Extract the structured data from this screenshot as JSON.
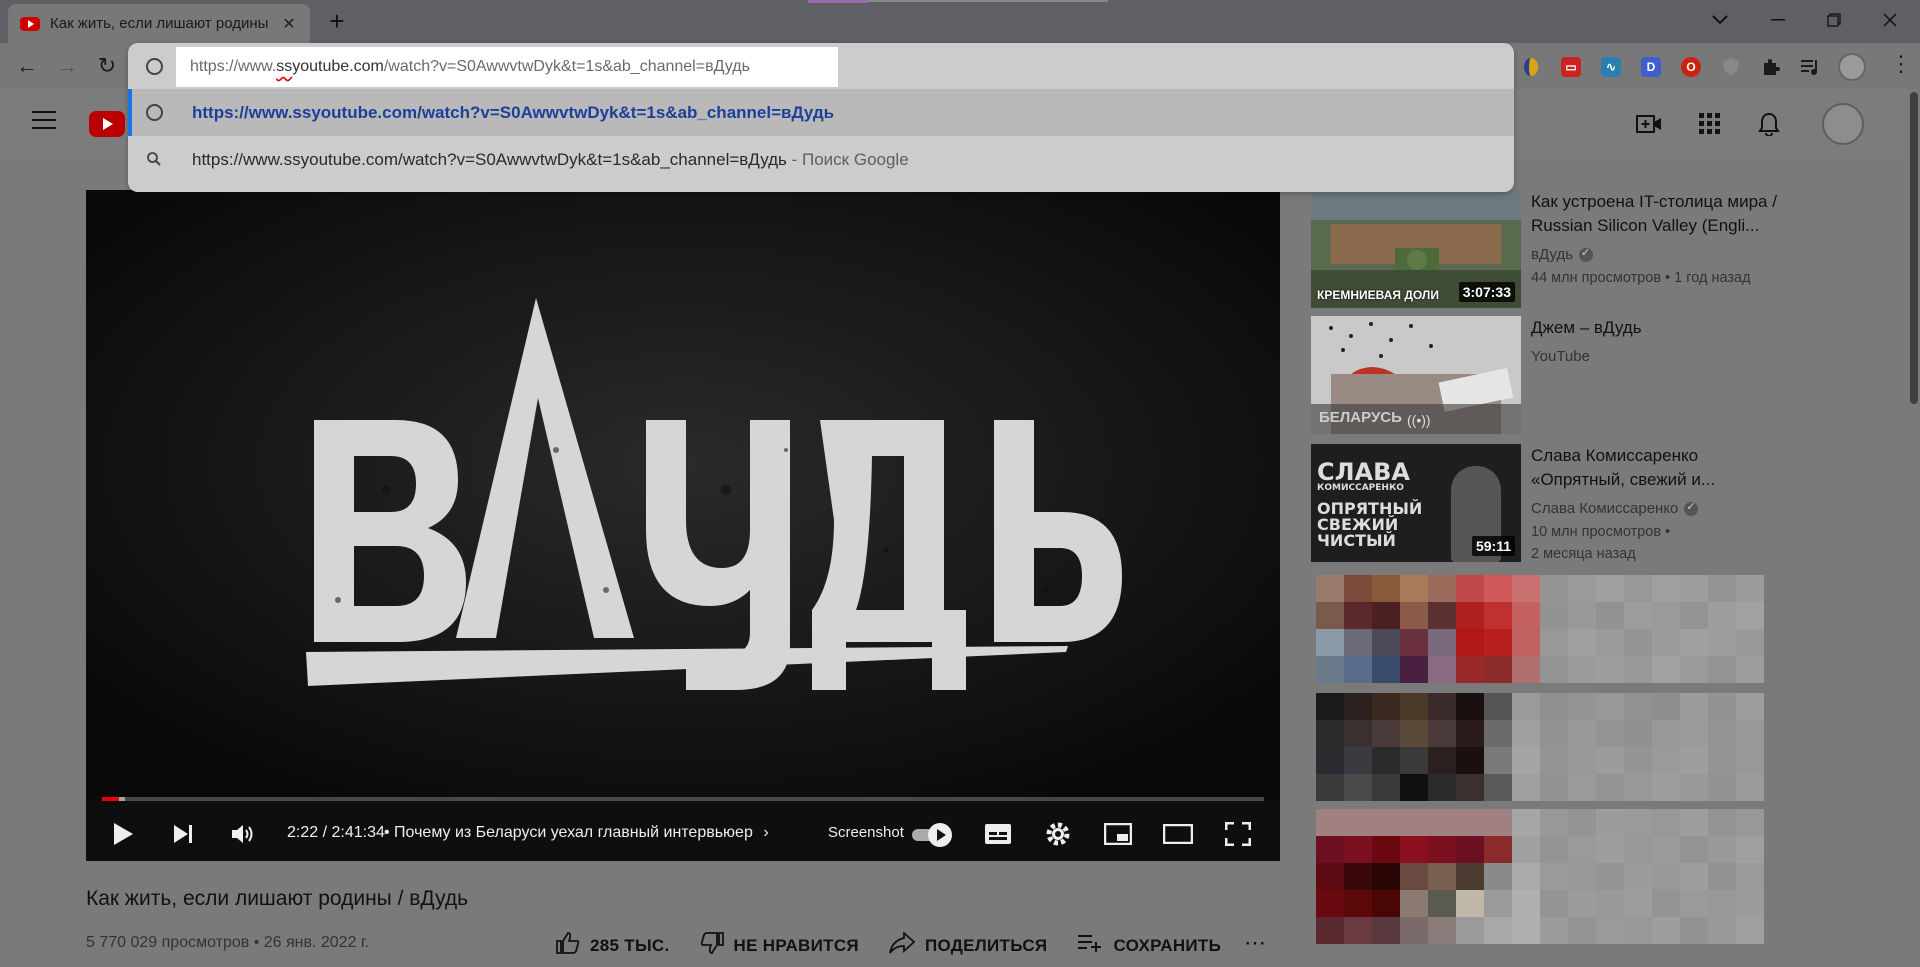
{
  "browser": {
    "tab_title": "Как жить, если лишают родины",
    "omnibox": {
      "input_scheme": "https://www.",
      "input_highlight": "ss",
      "input_host_rest": "youtube.com",
      "input_path": "/watch?v=S0AwwvtwDyk&t=1s&ab_channel=вДудь",
      "selected_suggestion": "https://www.ssyoutube.com/watch?v=S0AwwvtwDyk&t=1s&ab_channel=вДудь",
      "search_suggestion": "https://www.ssyoutube.com/watch?v=S0AwwvtwDyk&t=1s&ab_channel=вДудь",
      "search_hint": " - Поиск Google"
    },
    "extensions": [
      "ext-yellow-icon",
      "ext-red-icon",
      "ext-pulse-icon",
      "ext-d-icon",
      "ext-opera-icon",
      "ext-shield-icon",
      "puzzle-icon",
      "media-icon",
      "profile-avatar"
    ],
    "ext_d_letter": "D"
  },
  "player": {
    "logo_text": "вДудь",
    "progress_fraction": 0.0149,
    "buffered_fraction": 0.02,
    "current_time": "2:22",
    "time_separator": " / ",
    "duration": "2:41:34",
    "chapter": "• Почему из Беларуси уехал главный интервьюер",
    "screenshot_label": "Screenshot"
  },
  "video": {
    "title": "Как жить, если лишают родины / вДудь",
    "meta": "5 770 029 просмотров • 26 янв. 2022 г.",
    "likes_label": "285 ТЫС.",
    "dislike_label": "НЕ НРАВИТСЯ",
    "share_label": "ПОДЕЛИТЬСЯ",
    "save_label": "СОХРАНИТЬ"
  },
  "recommendations": [
    {
      "title": "Как устроена IT-столица мира / Russian Silicon Valley (Engli...",
      "channel": "вДудь",
      "stats": "44 млн просмотров • 1 год назад",
      "duration": "3:07:33",
      "thumb_caption": "КРЕМНИЕВАЯ ДОЛИ"
    },
    {
      "title": "Джем – вДудь",
      "channel": "YouTube",
      "thumb_caption": "БЕЛАРУСЬ"
    },
    {
      "title": "Слава Комиссаренко «Опрятный, свежий и...",
      "channel": "Слава Комиссаренко",
      "stats_line1": "10 млн просмотров •",
      "stats_line2": "2 месяца назад",
      "duration": "59:11",
      "thumb_text1": "СЛАВА",
      "thumb_text2": "КОМИССАРЕНКО",
      "thumb_text3": "ОПРЯТНЫЙ",
      "thumb_text4": "СВЕЖИЙ",
      "thumb_text5": "ЧИСТЫЙ"
    }
  ]
}
